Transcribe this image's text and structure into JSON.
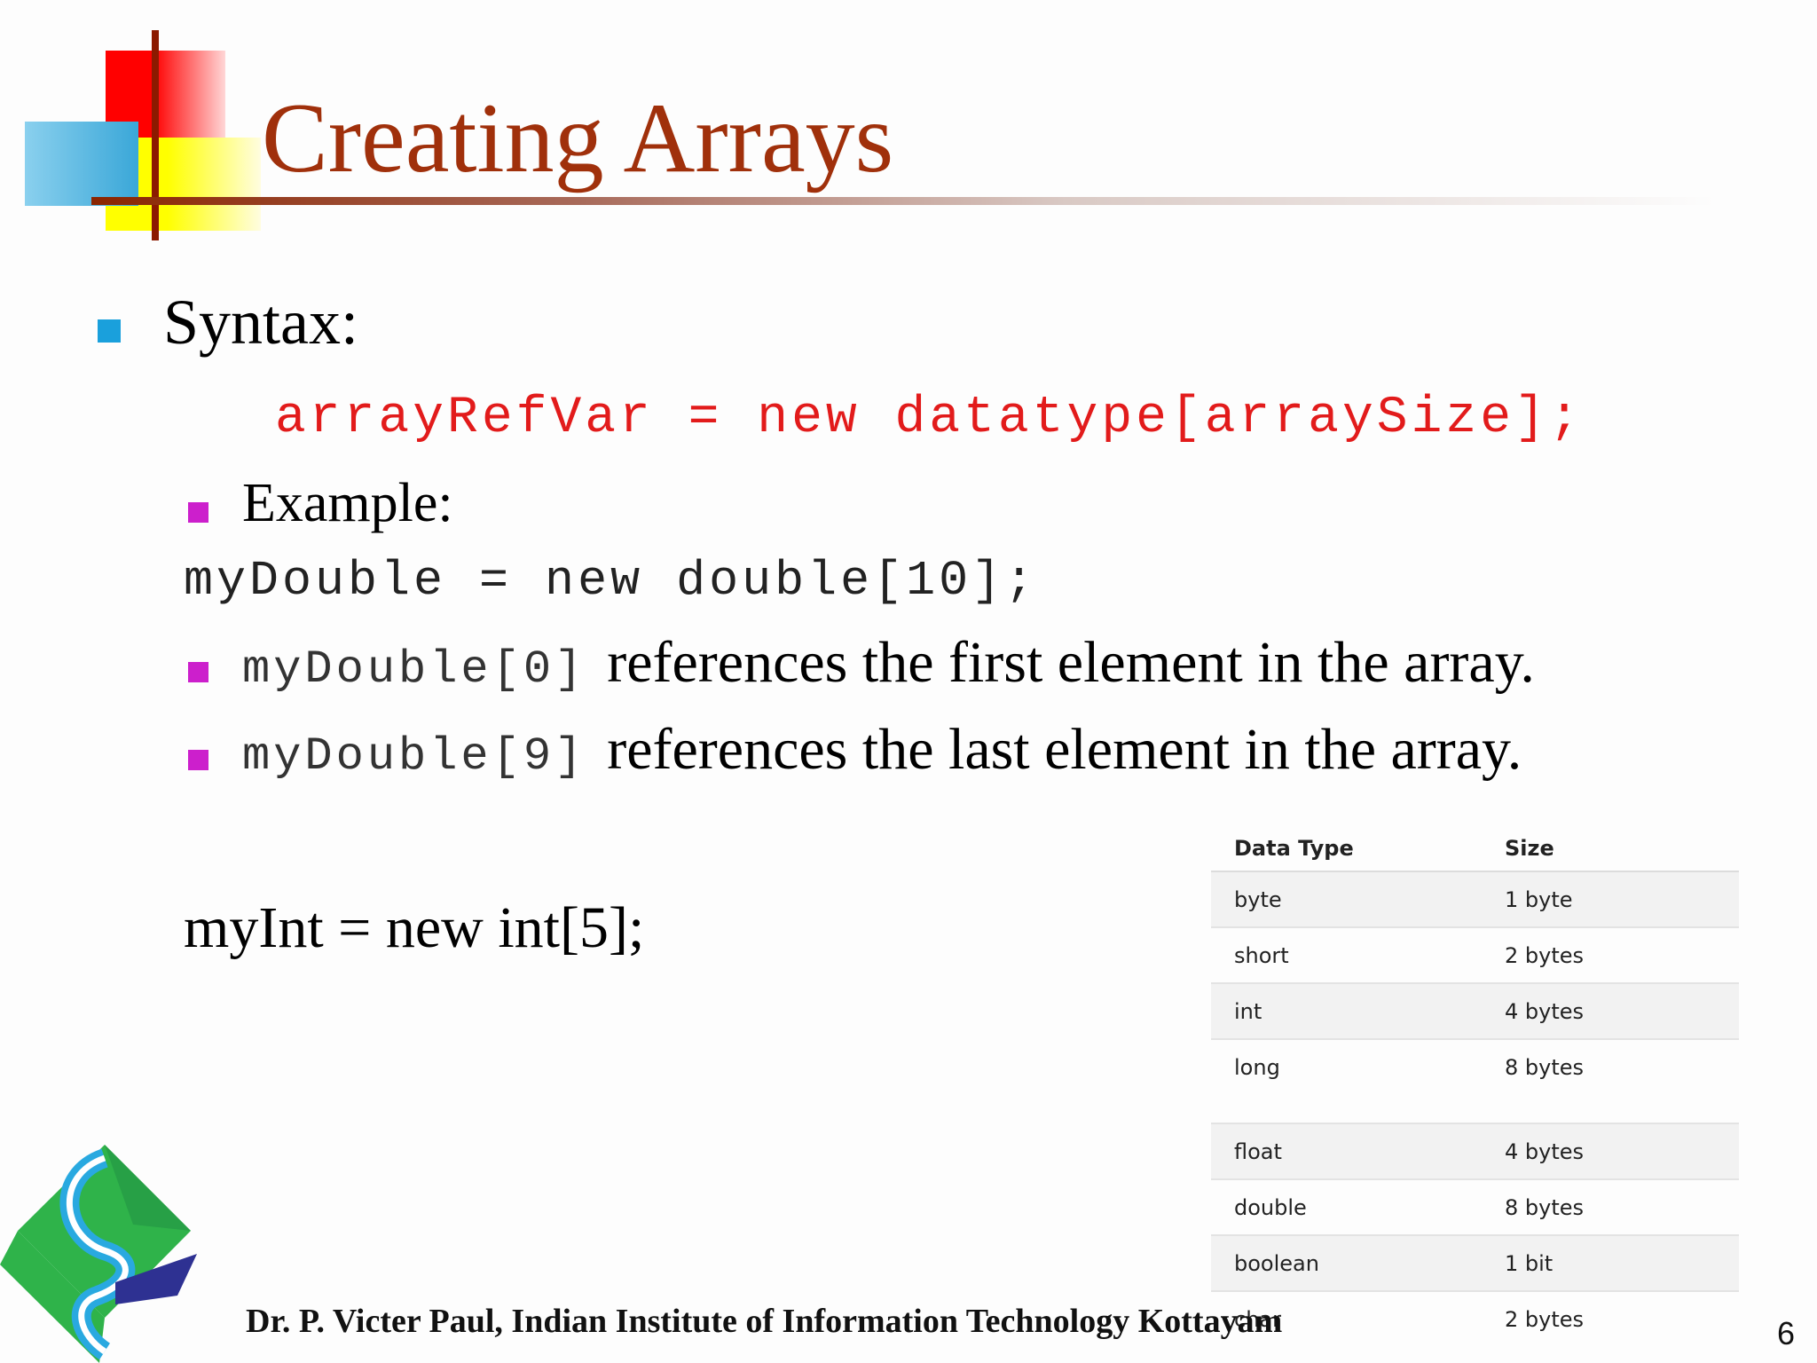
{
  "slide": {
    "title": "Creating Arrays",
    "syntax_label": "Syntax:",
    "syntax_code": "arrayRefVar = new datatype[arraySize];",
    "example_label": "Example:",
    "example_code": "myDouble = new double[10];",
    "ref_first": {
      "code": "myDouble[0]",
      "text": "references the first element in the array."
    },
    "ref_last": {
      "code": "myDouble[9]",
      "text": "references the last element in the array."
    },
    "myint_line": "myInt = new int[5];",
    "footer": "Dr. P. Victer Paul, Indian Institute of Information Technology Kottayam",
    "page_number": "6"
  },
  "table": {
    "headers": [
      "Data Type",
      "Size"
    ],
    "rows": [
      [
        "byte",
        "1 byte"
      ],
      [
        "short",
        "2 bytes"
      ],
      [
        "int",
        "4 bytes"
      ],
      [
        "long",
        "8 bytes"
      ],
      [
        "float",
        "4 bytes"
      ],
      [
        "double",
        "8 bytes"
      ],
      [
        "boolean",
        "1 bit"
      ],
      [
        "char",
        "2 bytes"
      ]
    ]
  },
  "colors": {
    "title": "#a0300b",
    "syntax_code": "#e21b1b",
    "bullet_primary": "#1aa0dc",
    "bullet_secondary": "#cc1fcc"
  }
}
